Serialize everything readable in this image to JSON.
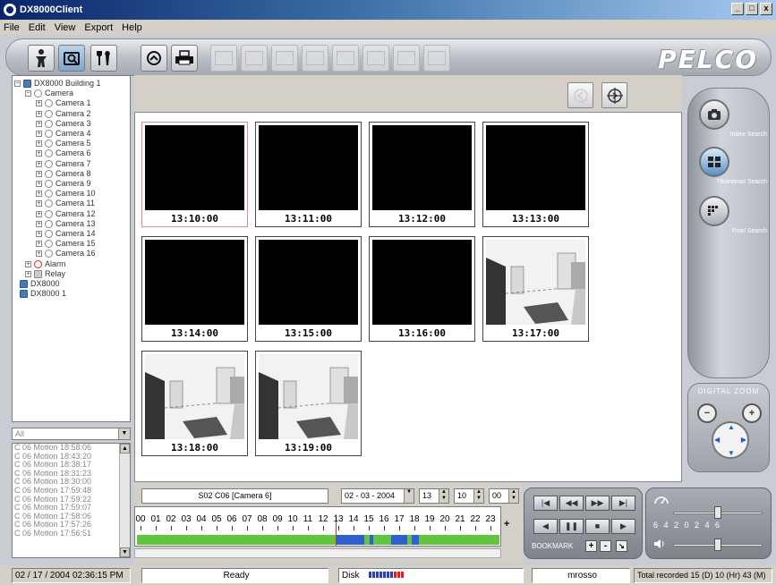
{
  "window": {
    "title": "DX8000Client",
    "controls": [
      "_",
      "□",
      "x"
    ]
  },
  "menu": [
    "File",
    "Edit",
    "View",
    "Export",
    "Help"
  ],
  "toolbar": {
    "brand": "PELCO"
  },
  "tree": {
    "root": "DX8000 Building 1",
    "camera_group": "Camera",
    "cameras": [
      "Camera 1",
      "Camera 2",
      "Camera 3",
      "Camera 4",
      "Camera 5",
      "Camera 6",
      "Camera 7",
      "Camera 8",
      "Camera 9",
      "Camera 10",
      "Camera 11",
      "Camera 12",
      "Camera 13",
      "Camera 14",
      "Camera 15",
      "Camera 16"
    ],
    "alarm": "Alarm",
    "relay": "Relay",
    "dx8000": "DX8000",
    "dx8000_1": "DX8000 1"
  },
  "event_filter": {
    "selected": "All"
  },
  "events": [
    "C 06 Motion 18:58:06",
    "C 06 Motion 18:43:20",
    "C 06 Motion 18:38:17",
    "C 06 Motion 18:31:23",
    "C 06 Motion 18:30:00",
    "C 06 Motion 17:59:48",
    "C 06 Motion 17:59:22",
    "C 06 Motion 17:59:07",
    "C 06 Motion 17:58:06",
    "C 06 Motion 17:57:26",
    "C 06 Motion 17:56:51"
  ],
  "thumbnails": [
    {
      "time": "13:10:00",
      "scene": "black",
      "selected": true
    },
    {
      "time": "13:11:00",
      "scene": "black",
      "selected": false
    },
    {
      "time": "13:12:00",
      "scene": "black",
      "selected": false
    },
    {
      "time": "13:13:00",
      "scene": "black",
      "selected": false
    },
    {
      "time": "13:14:00",
      "scene": "black",
      "selected": false
    },
    {
      "time": "13:15:00",
      "scene": "black",
      "selected": false
    },
    {
      "time": "13:16:00",
      "scene": "black",
      "selected": false
    },
    {
      "time": "13:17:00",
      "scene": "room",
      "selected": false
    },
    {
      "time": "13:18:00",
      "scene": "room",
      "selected": false
    },
    {
      "time": "13:19:00",
      "scene": "room",
      "selected": false
    }
  ],
  "search": {
    "index_label": "Index Search",
    "thumbnail_label": "Thumbnail Search",
    "pixel_label": "Pixel Search",
    "active": "thumbnail"
  },
  "zoom": {
    "title": "DIGITAL ZOOM"
  },
  "timeline": {
    "camera_label": "S02 C06 [Camera 6]",
    "date": "02 - 03 - 2004",
    "hour": "13",
    "minute": "10",
    "second": "00",
    "hours": [
      "00",
      "01",
      "02",
      "03",
      "04",
      "05",
      "06",
      "07",
      "08",
      "09",
      "10",
      "11",
      "12",
      "13",
      "14",
      "15",
      "16",
      "17",
      "18",
      "19",
      "20",
      "21",
      "22",
      "23"
    ],
    "plus": "+"
  },
  "playback": {
    "bookmark_label": "BOOKMARK",
    "bookmark_add": "+",
    "bookmark_remove": "-"
  },
  "speed": {
    "scale": "6 4 2 0 2 4 6"
  },
  "status": {
    "datetime": "02 / 17 / 2004  02:36:15 PM",
    "state": "Ready",
    "disk_label": "Disk",
    "user": "mrosso",
    "total": "Total recorded 15 (D) 10 (Hr) 43 (M)"
  },
  "colors": {
    "recorded": "#63c442",
    "motion": "#2f5fd1",
    "accent": "#0a246a"
  }
}
